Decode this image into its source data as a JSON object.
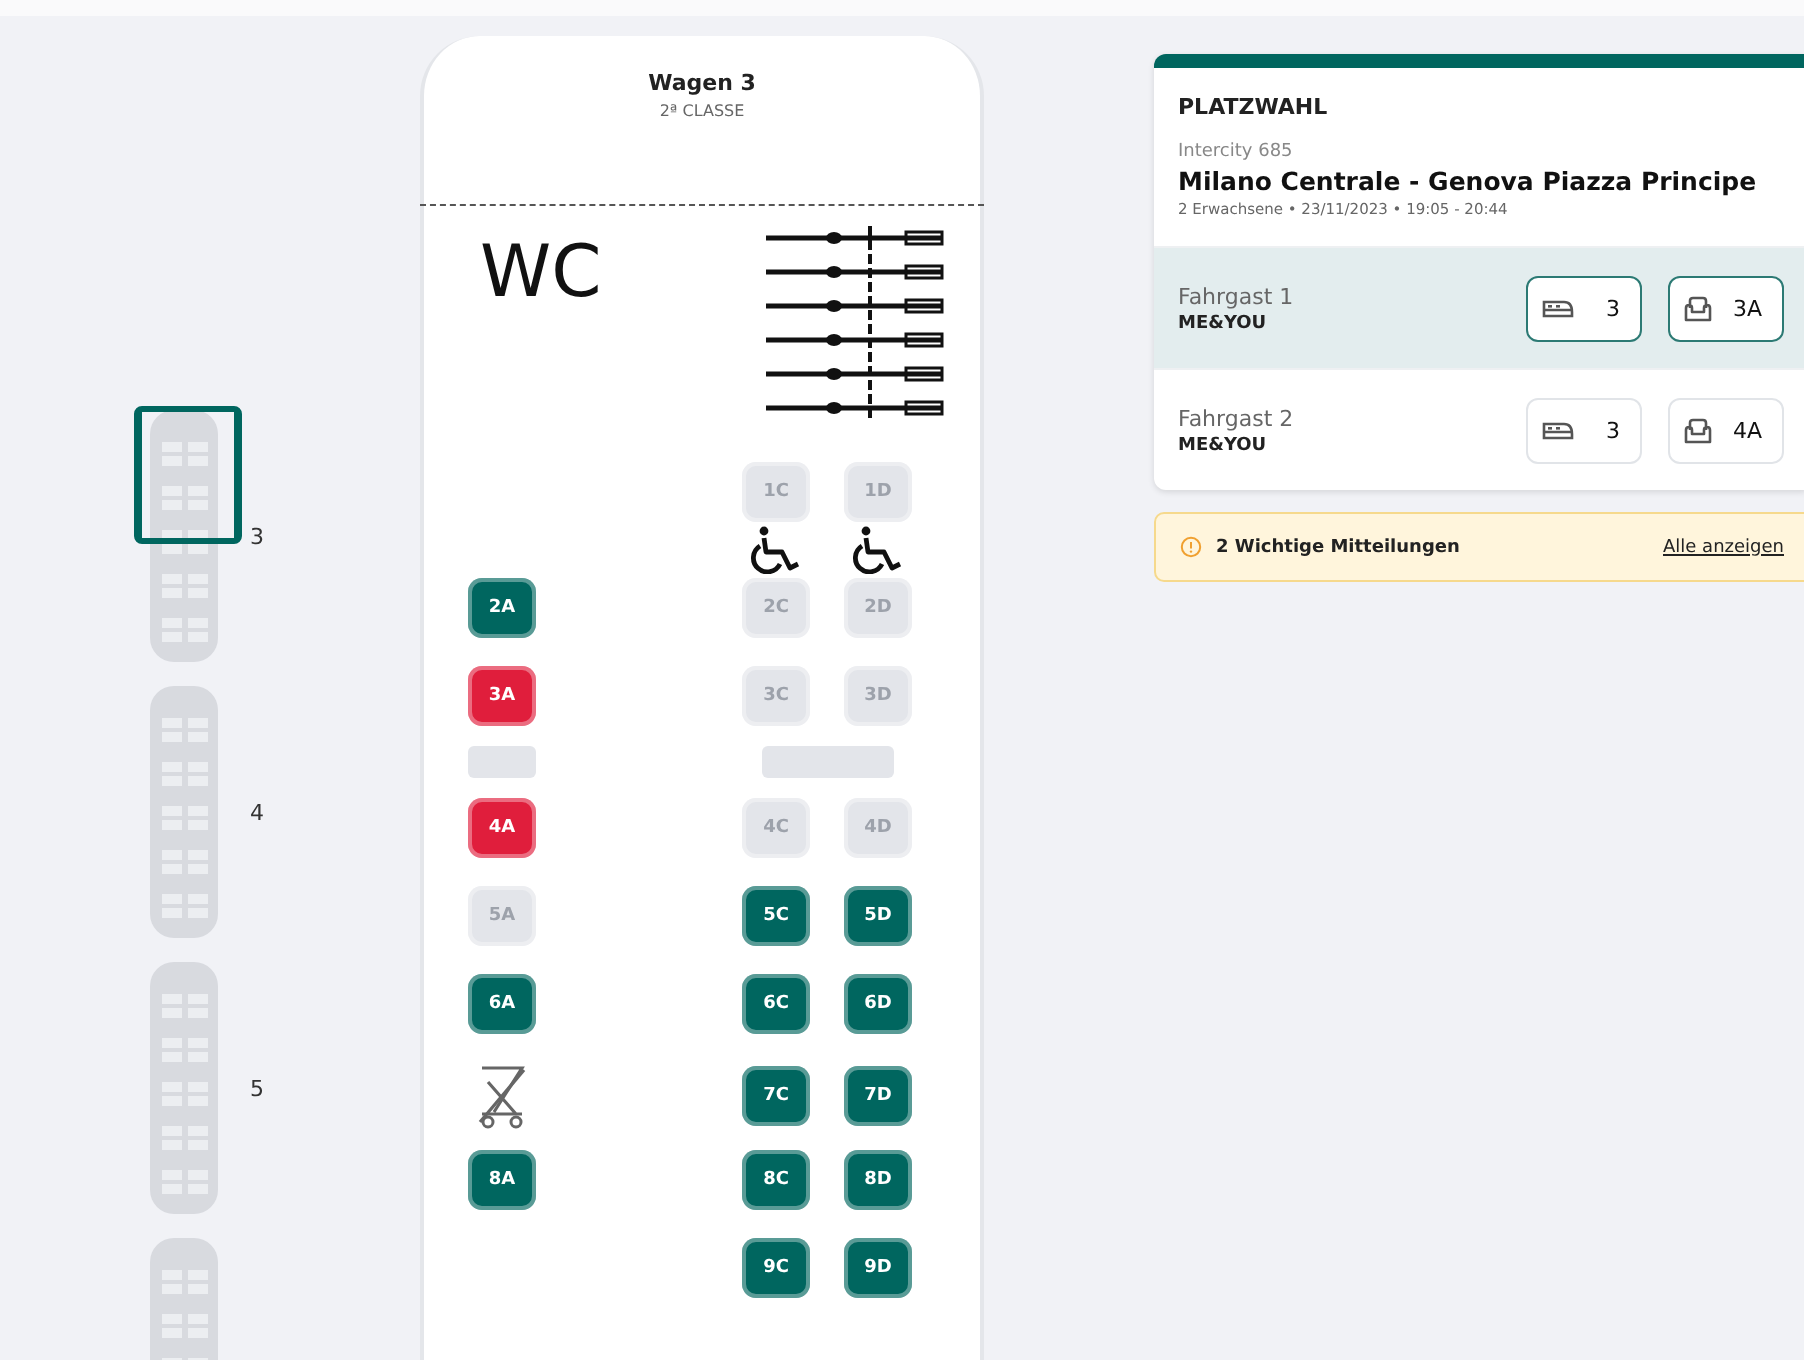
{
  "minimap": {
    "cars": [
      {
        "number": "3",
        "selected": true
      },
      {
        "number": "4",
        "selected": false
      },
      {
        "number": "5",
        "selected": false
      },
      {
        "selected": false
      }
    ]
  },
  "car": {
    "title": "Wagen 3",
    "class": "2ª CLASSE",
    "wc_label": "WC",
    "rows": [
      {
        "kind": "seats",
        "cells": [
          {
            "kind": "empty"
          },
          {
            "kind": "seat",
            "label": "1C",
            "taken": true,
            "selected": false
          },
          {
            "kind": "seat",
            "label": "1D",
            "taken": true,
            "selected": false
          }
        ]
      },
      {
        "kind": "aids",
        "cells": [
          {
            "kind": "empty"
          },
          {
            "kind": "wheelchair"
          },
          {
            "kind": "wheelchair"
          }
        ]
      },
      {
        "kind": "seats",
        "cells": [
          {
            "kind": "seat",
            "label": "2A",
            "taken": false,
            "selected": false
          },
          {
            "kind": "seat",
            "label": "2C",
            "taken": true,
            "selected": false
          },
          {
            "kind": "seat",
            "label": "2D",
            "taken": true,
            "selected": false
          }
        ]
      },
      {
        "kind": "seats",
        "cells": [
          {
            "kind": "seat",
            "label": "3A",
            "taken": false,
            "selected": true
          },
          {
            "kind": "seat",
            "label": "3C",
            "taken": true,
            "selected": false
          },
          {
            "kind": "seat",
            "label": "3D",
            "taken": true,
            "selected": false
          }
        ]
      },
      {
        "kind": "tables",
        "cells": [
          {
            "kind": "table"
          },
          {
            "kind": "table-wide"
          }
        ]
      },
      {
        "kind": "seats",
        "cells": [
          {
            "kind": "seat",
            "label": "4A",
            "taken": false,
            "selected": true
          },
          {
            "kind": "seat",
            "label": "4C",
            "taken": true,
            "selected": false
          },
          {
            "kind": "seat",
            "label": "4D",
            "taken": true,
            "selected": false
          }
        ]
      },
      {
        "kind": "seats",
        "cells": [
          {
            "kind": "seat",
            "label": "5A",
            "taken": true,
            "selected": false
          },
          {
            "kind": "seat",
            "label": "5C",
            "taken": false,
            "selected": false
          },
          {
            "kind": "seat",
            "label": "5D",
            "taken": false,
            "selected": false
          }
        ]
      },
      {
        "kind": "seats",
        "cells": [
          {
            "kind": "seat",
            "label": "6A",
            "taken": false,
            "selected": false
          },
          {
            "kind": "seat",
            "label": "6C",
            "taken": false,
            "selected": false
          },
          {
            "kind": "seat",
            "label": "6D",
            "taken": false,
            "selected": false
          }
        ]
      },
      {
        "kind": "seats",
        "cells": [
          {
            "kind": "stroller"
          },
          {
            "kind": "seat",
            "label": "7C",
            "taken": false,
            "selected": false
          },
          {
            "kind": "seat",
            "label": "7D",
            "taken": false,
            "selected": false
          }
        ]
      },
      {
        "kind": "seats",
        "cells": [
          {
            "kind": "seat",
            "label": "8A",
            "taken": false,
            "selected": false
          },
          {
            "kind": "seat",
            "label": "8C",
            "taken": false,
            "selected": false
          },
          {
            "kind": "seat",
            "label": "8D",
            "taken": false,
            "selected": false
          }
        ]
      },
      {
        "kind": "seats",
        "cells": [
          {
            "kind": "empty"
          },
          {
            "kind": "seat",
            "label": "9C",
            "taken": false,
            "selected": false
          },
          {
            "kind": "seat",
            "label": "9D",
            "taken": false,
            "selected": false
          }
        ]
      }
    ]
  },
  "panel": {
    "title": "PLATZWAHL",
    "train": "Intercity 685",
    "route": "Milano Centrale - Genova Piazza Principe",
    "details": "2 Erwachsene • 23/11/2023 • 19:05 - 20:44",
    "passengers": [
      {
        "name": "Fahrgast 1",
        "group": "ME&YOU",
        "car": "3",
        "seat": "3A",
        "selected": true
      },
      {
        "name": "Fahrgast 2",
        "group": "ME&YOU",
        "car": "3",
        "seat": "4A",
        "selected": false
      }
    ]
  },
  "notice": {
    "text": "2 Wichtige Mitteilungen",
    "link": "Alle anzeigen"
  }
}
